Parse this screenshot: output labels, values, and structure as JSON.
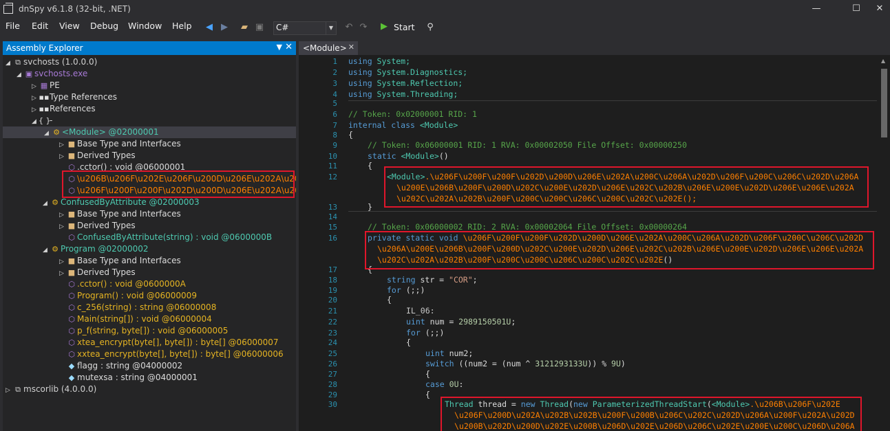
{
  "window": {
    "title": "dnSpy v6.1.8 (32-bit, .NET)",
    "minimize": "—",
    "maximize": "☐",
    "close": "✕"
  },
  "menu": [
    "File",
    "Edit",
    "View",
    "Debug",
    "Window",
    "Help"
  ],
  "toolbar": {
    "language": "C#",
    "start_label": "Start"
  },
  "assembly_explorer": {
    "title": "Assembly Explorer",
    "nodes": [
      {
        "label": "svchosts (1.0.0.0)"
      },
      {
        "label": "svchosts.exe"
      },
      {
        "label": "PE"
      },
      {
        "label": "Type References"
      },
      {
        "label": "References"
      },
      {
        "label": "-"
      },
      {
        "label": "<Module> @02000001"
      },
      {
        "label": "Base Type and Interfaces"
      },
      {
        "label": "Derived Types"
      },
      {
        "label": ".cctor() : void @06000001"
      },
      {
        "label": "\\u206B\\u206F\\u202E\\u206F\\u200D\\u206E\\u202A\\u202B\\u202B\\u"
      },
      {
        "label": "\\u206F\\u200F\\u200F\\u202D\\u200D\\u206E\\u202A\\u200C\\u"
      },
      {
        "label": "ConfusedByAttribute @02000003"
      },
      {
        "label": "Base Type and Interfaces"
      },
      {
        "label": "Derived Types"
      },
      {
        "label": "ConfusedByAttribute(string) : void @0600000B"
      },
      {
        "label": "Program @02000002"
      },
      {
        "label": "Base Type and Interfaces"
      },
      {
        "label": "Derived Types"
      },
      {
        "label": ".cctor() : void @0600000A"
      },
      {
        "label": "Program() : void @06000009"
      },
      {
        "label": "c_256(string) : string @06000008"
      },
      {
        "label": "Main(string[]) : void @06000004"
      },
      {
        "label": "p_f(string, byte[]) : void @06000005"
      },
      {
        "label": "xtea_encrypt(byte[], byte[]) : byte[] @06000007"
      },
      {
        "label": "xxtea_encrypt(byte[], byte[]) : byte[] @06000006"
      },
      {
        "label": "flagg : string @04000002"
      },
      {
        "label": "mutexsa : string @04000001"
      },
      {
        "label": "mscorlib (4.0.0.0)"
      }
    ]
  },
  "editor": {
    "tab_label": "<Module>",
    "line_numbers": [
      "1",
      "2",
      "3",
      "4",
      "5",
      "6",
      "7",
      "8",
      "9",
      "10",
      "11",
      "12",
      "13",
      "14",
      "15",
      "16",
      "17",
      "18",
      "19",
      "20",
      "21",
      "22",
      "23",
      "24",
      "25",
      "26",
      "27",
      "28",
      "29",
      "30"
    ],
    "lines": {
      "l1": [
        "using",
        " System;"
      ],
      "l2": [
        "using",
        " System.Diagnostics;"
      ],
      "l3": [
        "using",
        " System.Reflection;"
      ],
      "l4": [
        "using",
        " System.Threading;"
      ],
      "l6": "// Token: 0x02000001 RID: 1",
      "l7": [
        "internal class ",
        "<Module>"
      ],
      "l8": "{",
      "l9": "// Token: 0x06000001 RID: 1 RVA: 0x00002050 File Offset: 0x00000250",
      "l10": [
        "static ",
        "<Module>",
        "()"
      ],
      "l11": "{",
      "l12a": [
        "<Module>",
        ".\\u206F\\u200F\\u200F\\u202D\\u200D\\u206E\\u202A\\u200C\\u206A\\u202D\\u206F\\u200C\\u206C\\u202D\\u206A"
      ],
      "l12b": "\\u200E\\u206B\\u200F\\u200D\\u202C\\u200E\\u202D\\u206E\\u202C\\u202B\\u206E\\u200E\\u202D\\u206E\\u206E\\u202A",
      "l12c": "\\u202C\\u202A\\u202B\\u200F\\u200C\\u200C\\u206C\\u200C\\u202C\\u202E();",
      "l13": "}",
      "l15": "// Token: 0x06000002 RID: 2 RVA: 0x00002064 File Offset: 0x00000264",
      "l16a": [
        "private static void ",
        "\\u206F\\u200F\\u200F\\u202D\\u200D\\u206E\\u202A\\u200C\\u206A\\u202D\\u206F\\u200C\\u206C\\u202D"
      ],
      "l16b": "\\u206A\\u200E\\u206B\\u200F\\u200D\\u202C\\u200E\\u202D\\u206E\\u202C\\u202B\\u206E\\u200E\\u202D\\u206E\\u206E\\u202A",
      "l16c": [
        "\\u202C\\u202A\\u202B\\u200F\\u200C\\u200C\\u206C\\u200C\\u202C\\u202E",
        "()"
      ],
      "l17": "{",
      "l18": [
        "string",
        " str = ",
        "\"COR\"",
        ";"
      ],
      "l19": [
        "for",
        " (;;)"
      ],
      "l20": "{",
      "l21": "IL_06:",
      "l22": [
        "uint",
        " num = ",
        "2989150501U",
        ";"
      ],
      "l23": [
        "for",
        " (;;)"
      ],
      "l24": "{",
      "l25": [
        "uint",
        " num2;"
      ],
      "l26": [
        "switch",
        " ((num2 = (num ^ ",
        "3121293133U",
        ")) % ",
        "9U",
        ")"
      ],
      "l27": "{",
      "l28": [
        "case",
        " ",
        "0U",
        ":"
      ],
      "l29": "{",
      "l30a": [
        "Thread",
        " thread = ",
        "new",
        " ",
        "Thread",
        "(",
        "new",
        " ",
        "ParameterizedThreadStart",
        "(",
        "<Module>",
        ".\\u206B\\u206F\\u202E"
      ],
      "l30b": "\\u206F\\u200D\\u202A\\u202B\\u202B\\u200F\\u200B\\u206C\\u202C\\u202D\\u206A\\u200F\\u202A\\u202D",
      "l30c": "\\u200B\\u202D\\u200D\\u202E\\u200B\\u206D\\u202E\\u206D\\u206C\\u202E\\u200E\\u200C\\u206D\\u206A"
    }
  }
}
